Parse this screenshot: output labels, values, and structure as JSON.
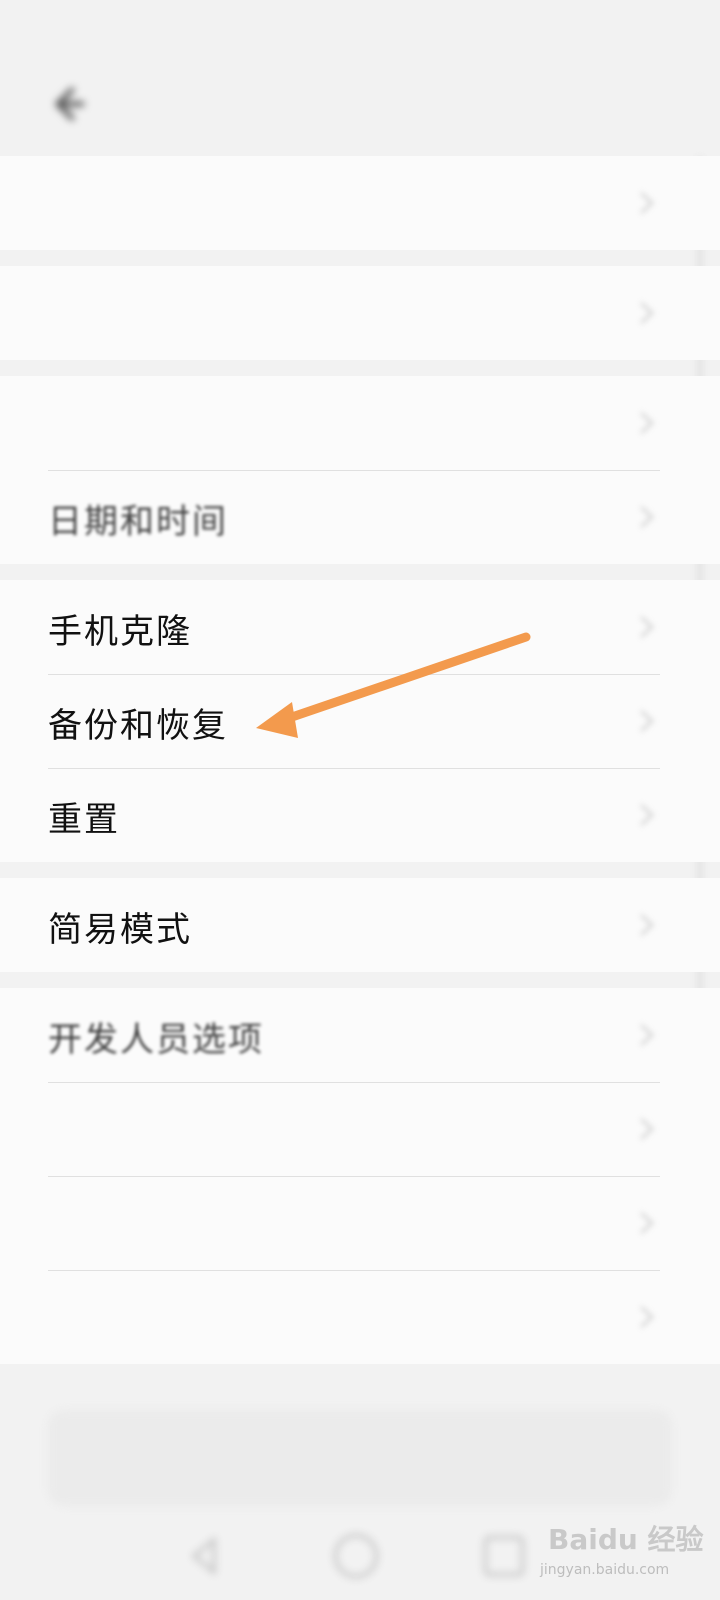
{
  "status_bar": {
    "left_text": "",
    "right_text": ""
  },
  "header": {
    "title": "",
    "back_icon": "back-arrow-icon"
  },
  "groups": [
    {
      "items": [
        {
          "label": "",
          "blur": "strong"
        }
      ]
    },
    {
      "items": [
        {
          "label": "",
          "blur": "strong"
        }
      ]
    },
    {
      "items": [
        {
          "label": "",
          "blur": "mid"
        },
        {
          "label": "日期和时间",
          "blur": "light"
        }
      ]
    },
    {
      "items": [
        {
          "label": "手机克隆",
          "blur": "none"
        },
        {
          "label": "备份和恢复",
          "blur": "none"
        },
        {
          "label": "重置",
          "blur": "none"
        }
      ]
    },
    {
      "items": [
        {
          "label": "简易模式",
          "blur": "none"
        }
      ]
    },
    {
      "items": [
        {
          "label": "开发人员选项",
          "blur": "light"
        },
        {
          "label": "",
          "blur": "strong",
          "value": ""
        },
        {
          "label": "",
          "blur": "strong"
        },
        {
          "label": "",
          "blur": "strong"
        }
      ]
    }
  ],
  "search": {
    "placeholder": ""
  },
  "annotation": {
    "color": "#f39a4d"
  },
  "watermark": {
    "text": "Baidu 经验",
    "sub": "jingyan.baidu.com"
  },
  "colors": {
    "background": "#f2f2f2",
    "card": "#fbfbfb",
    "divider": "#e0e0e0",
    "text": "#111111"
  }
}
